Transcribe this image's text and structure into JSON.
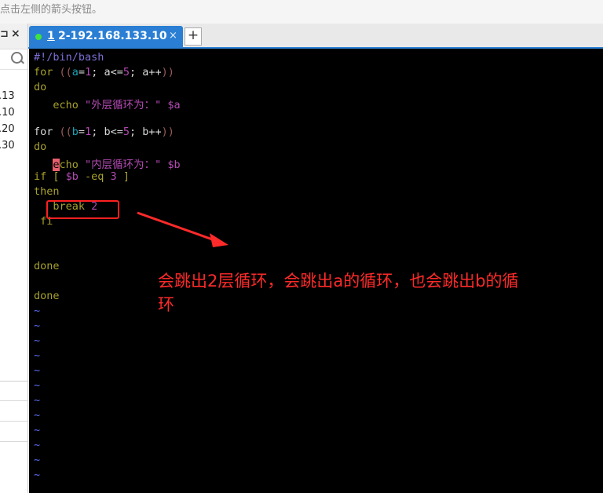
{
  "hint_text": "点击左侧的箭头按钮。",
  "left_panel": {
    "hosts": [
      ".13",
      ".10",
      ".20",
      ".30"
    ]
  },
  "tab": {
    "index": "1",
    "title": "2-192.168.133.10",
    "close_glyph": "×",
    "add_glyph": "+",
    "status_color": "#3fe23f"
  },
  "terminal": {
    "lines": [
      {
        "id": "l1",
        "segments": [
          [
            "c-comment",
            "#!/bin/bash"
          ]
        ]
      },
      {
        "id": "l2",
        "segments": [
          [
            "c-kw",
            "for "
          ],
          [
            "c-paren",
            "(("
          ],
          [
            "c-var",
            "a"
          ],
          [
            "c-op",
            "="
          ],
          [
            "c-num",
            "1"
          ],
          [
            "c-op",
            "; a<="
          ],
          [
            "c-num",
            "5"
          ],
          [
            "c-op",
            "; a++"
          ],
          [
            "c-paren",
            "))"
          ]
        ]
      },
      {
        "id": "l3",
        "segments": [
          [
            "c-kw",
            "do"
          ]
        ]
      },
      {
        "id": "l4",
        "segments": [
          [
            "c-op",
            "   "
          ],
          [
            "c-cmd",
            "echo "
          ],
          [
            "c-str",
            "\"外层循环为：\" $a"
          ]
        ]
      },
      {
        "id": "l5",
        "segments": []
      },
      {
        "id": "l6",
        "segments": [
          [
            "c-op",
            "for "
          ],
          [
            "c-paren",
            "(("
          ],
          [
            "c-var",
            "b"
          ],
          [
            "c-op",
            "="
          ],
          [
            "c-num",
            "1"
          ],
          [
            "c-op",
            "; b<="
          ],
          [
            "c-num",
            "5"
          ],
          [
            "c-op",
            "; b++"
          ],
          [
            "c-paren",
            "))"
          ]
        ]
      },
      {
        "id": "l7",
        "segments": [
          [
            "c-kw",
            "do"
          ]
        ]
      },
      {
        "id": "l8",
        "segments": [
          [
            "c-op",
            "   "
          ],
          [
            "cursor",
            "e"
          ],
          [
            "c-cmd",
            "cho "
          ],
          [
            "c-str",
            "\"内层循环为：\" $b"
          ]
        ]
      },
      {
        "id": "l9",
        "segments": [
          [
            "c-kw",
            "if [ "
          ],
          [
            "c-str",
            "$b"
          ],
          [
            "c-kw",
            " -eq "
          ],
          [
            "c-num",
            "3"
          ],
          [
            "c-kw",
            " ]"
          ]
        ]
      },
      {
        "id": "l10",
        "segments": [
          [
            "c-kw",
            "then"
          ]
        ]
      },
      {
        "id": "l11",
        "segments": [
          [
            "c-op",
            "   "
          ],
          [
            "c-kw",
            "break "
          ],
          [
            "c-num",
            "2"
          ]
        ]
      },
      {
        "id": "l12",
        "segments": [
          [
            "c-kw",
            " fi"
          ]
        ]
      },
      {
        "id": "l13",
        "segments": []
      },
      {
        "id": "l14",
        "segments": []
      },
      {
        "id": "l15",
        "segments": [
          [
            "c-kw",
            "done"
          ]
        ]
      },
      {
        "id": "l16",
        "segments": []
      },
      {
        "id": "l17",
        "segments": [
          [
            "c-kw",
            "done"
          ]
        ]
      }
    ],
    "tilde": "~",
    "tilde_count": 12
  },
  "annotation": {
    "text": "会跳出2层循环，会跳出a的循环，也会跳出b的循环",
    "color": "#ff2a2a"
  }
}
